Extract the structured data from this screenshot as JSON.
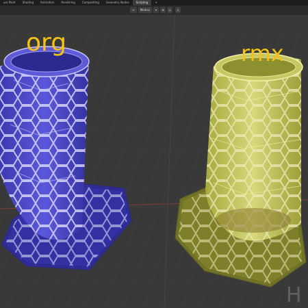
{
  "tabs": [
    "ure Paint",
    "Shading",
    "Animation",
    "Rendering",
    "Compositing",
    "Geometry Nodes",
    "Scripting"
  ],
  "active_tab_index": 6,
  "add_tab_label": "+",
  "header": {
    "pivot_label": "Median"
  },
  "viewport": {
    "left_label": "org",
    "right_label": "rmx",
    "watermark": "H"
  },
  "colors": {
    "background": "#3a3a3a",
    "label_color": "#f4c216",
    "org_mesh": "#4a46c4",
    "rmx_mesh": "#c8cb5a"
  },
  "icons": [
    "dropdown-icon",
    "snap-icon",
    "proportional-icon",
    "overlay-icon"
  ]
}
